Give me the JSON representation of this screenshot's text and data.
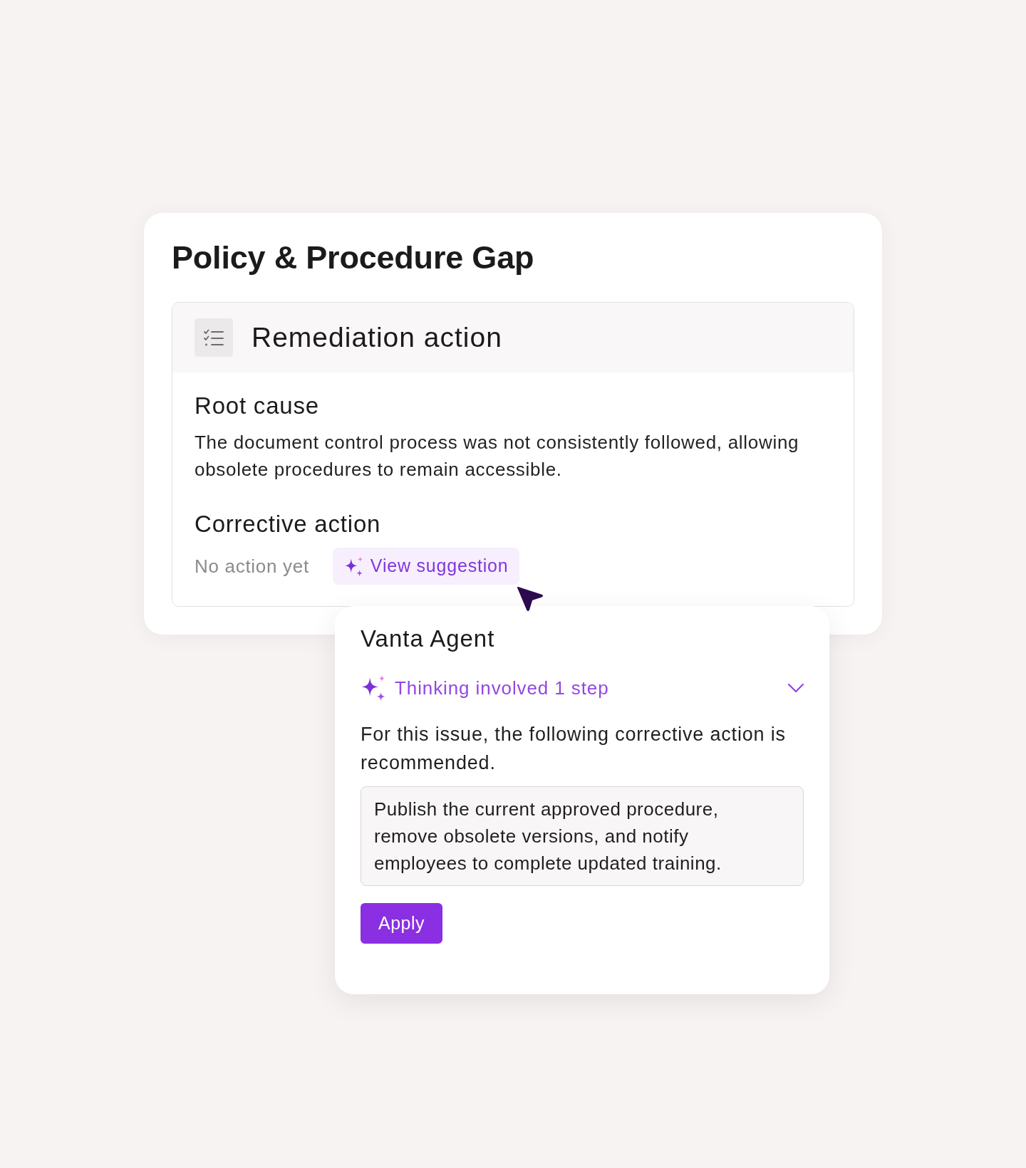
{
  "card": {
    "title": "Policy & Procedure Gap",
    "section": {
      "title": "Remediation action",
      "fields": [
        {
          "kind": "text",
          "label": "Root cause",
          "value": "The document control process was not consistently followed, allowing obsolete procedures to remain accessible."
        },
        {
          "kind": "empty",
          "label": "Corrective action",
          "value": "No action yet",
          "action": "View suggestion"
        }
      ]
    }
  },
  "agent_panel": {
    "title": "Vanta Agent",
    "thinking": {
      "label": "Thinking involved 1 step",
      "expanded": false
    },
    "message": "For this issue, the following corrective action is recommended.",
    "suggestion": "Publish the current approved procedure, remove obsolete versions, and notify employees to complete updated training.",
    "button": "Apply"
  }
}
